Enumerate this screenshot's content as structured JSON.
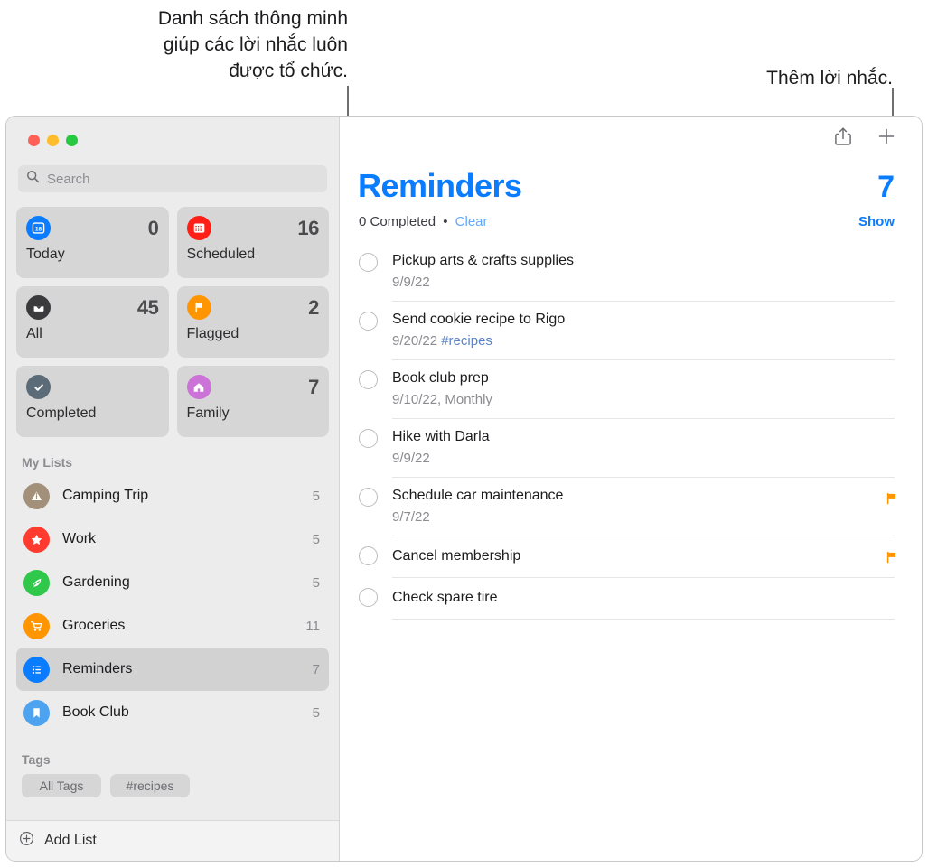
{
  "callouts": {
    "left": "Danh sách thông minh\ngiúp các lời nhắc luôn\nđược tổ chức.",
    "right": "Thêm lời nhắc."
  },
  "window_controls": {
    "close": "close-window",
    "minimize": "minimize-window",
    "zoom": "zoom-window"
  },
  "sidebar": {
    "search": {
      "placeholder": "Search",
      "value": "",
      "icon": "search-icon"
    },
    "smart_lists": [
      {
        "label": "Today",
        "count": "0",
        "icon": "calendar-day-icon",
        "color": "#0a7cff"
      },
      {
        "label": "Scheduled",
        "count": "16",
        "icon": "calendar-icon",
        "color": "#ff1f16"
      },
      {
        "label": "All",
        "count": "45",
        "icon": "inbox-icon",
        "color": "#3b3b3d"
      },
      {
        "label": "Flagged",
        "count": "2",
        "icon": "flag-icon",
        "color": "#ff9500"
      },
      {
        "label": "Completed",
        "count": "",
        "icon": "checkmark-icon",
        "color": "#5b6b77"
      },
      {
        "label": "Family",
        "count": "7",
        "icon": "house-icon",
        "color": "#c martial"
      }
    ],
    "my_lists_header": "My Lists",
    "my_lists": [
      {
        "name": "Camping Trip",
        "count": "5",
        "icon": "tent-icon",
        "color": "#a3907a"
      },
      {
        "name": "Work",
        "count": "5",
        "icon": "star-icon",
        "color": "#ff3b30"
      },
      {
        "name": "Gardening",
        "count": "5",
        "icon": "leaf-icon",
        "color": "#2fc84b"
      },
      {
        "name": "Groceries",
        "count": "11",
        "icon": "cart-icon",
        "color": "#ff9500"
      },
      {
        "name": "Reminders",
        "count": "7",
        "icon": "list-icon",
        "color": "#0a7cff",
        "selected": true
      },
      {
        "name": "Book Club",
        "count": "5",
        "icon": "bookmark-icon",
        "color": "#4da3f0"
      }
    ],
    "tags_header": "Tags",
    "tags": [
      "All Tags",
      "#recipes"
    ],
    "add_list": {
      "label": "Add List",
      "icon": "plus-circle-icon"
    }
  },
  "main": {
    "toolbar": {
      "share": "share-icon",
      "add": "plus-icon"
    },
    "title": "Reminders",
    "total": "7",
    "completed_text": "0 Completed",
    "separator": "•",
    "clear_label": "Clear",
    "show_label": "Show",
    "reminders": [
      {
        "title": "Pickup arts & crafts supplies",
        "date": "9/9/22",
        "tag": "",
        "flagged": false
      },
      {
        "title": "Send cookie recipe to Rigo",
        "date": "9/20/22",
        "tag": "#recipes",
        "flagged": false
      },
      {
        "title": "Book club prep",
        "date": "9/10/22, Monthly",
        "tag": "",
        "flagged": false
      },
      {
        "title": "Hike with Darla",
        "date": "9/9/22",
        "tag": "",
        "flagged": false
      },
      {
        "title": "Schedule car maintenance",
        "date": "9/7/22",
        "tag": "",
        "flagged": true
      },
      {
        "title": "Cancel membership",
        "date": "",
        "tag": "",
        "flagged": true
      },
      {
        "title": "Check spare tire",
        "date": "",
        "tag": "",
        "flagged": false
      }
    ]
  },
  "colors": {
    "accent": "#0a7cff",
    "flag": "#ff9500",
    "sidebar_bg": "#ececec",
    "card_bg": "#d6d6d7"
  }
}
